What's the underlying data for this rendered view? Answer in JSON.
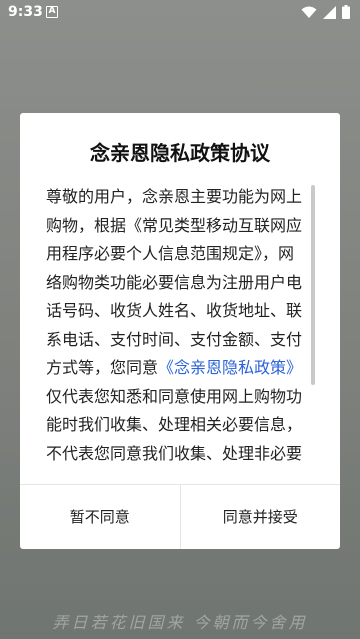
{
  "status_bar": {
    "time": "9:33",
    "notification_badge": "A",
    "icons": [
      "wifi-icon",
      "signal-icon",
      "battery-icon"
    ]
  },
  "dialog": {
    "title": "念亲恩隐私政策协议",
    "body_before_link": "尊敬的用户，念亲恩主要功能为网上购物，根据《常见类型移动互联网应用程序必要个人信息范围规定》，网络购物类功能必要信息为注册用户电话号码、收货人姓名、收货地址、联系电话、支付时间、支付金额、支付方式等，您同意",
    "policy_link": "《念亲恩隐私政策》",
    "body_after_link": "仅代表您知悉和同意使用网上购物功能时我们收集、处理相关必要信息，不代表您同意我们收集、处理非必要",
    "decline_label": "暂不同意",
    "accept_label": "同意并接受"
  },
  "background_watermark": "弄日若花旧国来 今朝而今舍用",
  "colors": {
    "link": "#2b63d9",
    "dialog_bg": "#ffffff",
    "overlay": "#7f817d"
  }
}
